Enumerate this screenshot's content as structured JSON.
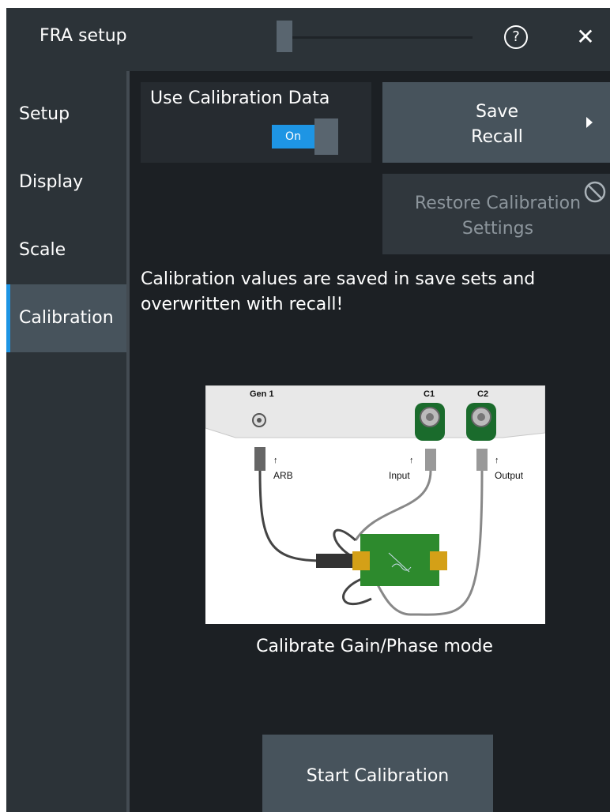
{
  "window": {
    "title": "FRA setup",
    "help_glyph": "?",
    "close_glyph": "✕",
    "icons": [
      "help-icon",
      "close-icon"
    ]
  },
  "sidebar": {
    "items": [
      {
        "label": "Setup",
        "active": false
      },
      {
        "label": "Display",
        "active": false
      },
      {
        "label": "Scale",
        "active": false
      },
      {
        "label": "Calibration",
        "active": true
      }
    ]
  },
  "calibration": {
    "use_label": "Use Calibration Data",
    "toggle_value": "On",
    "save_recall": [
      "Save",
      "Recall"
    ],
    "restore": [
      "Restore Calibration",
      "Settings"
    ],
    "restore_disabled": true,
    "info_line1": "Calibration values are saved in save sets and",
    "info_line2": "overwritten with recall!",
    "diagram": {
      "gen_label": "Gen 1",
      "c1_label": "C1",
      "c2_label": "C2",
      "arb_label": "ARB",
      "input_label": "Input",
      "output_label": "Output"
    },
    "caption": "Calibrate Gain/Phase mode",
    "start_button": "Start Calibration"
  },
  "colors": {
    "accent": "#1e95e4",
    "background": "#1c2024",
    "panel": "#2c3338",
    "button": "#47535c"
  }
}
